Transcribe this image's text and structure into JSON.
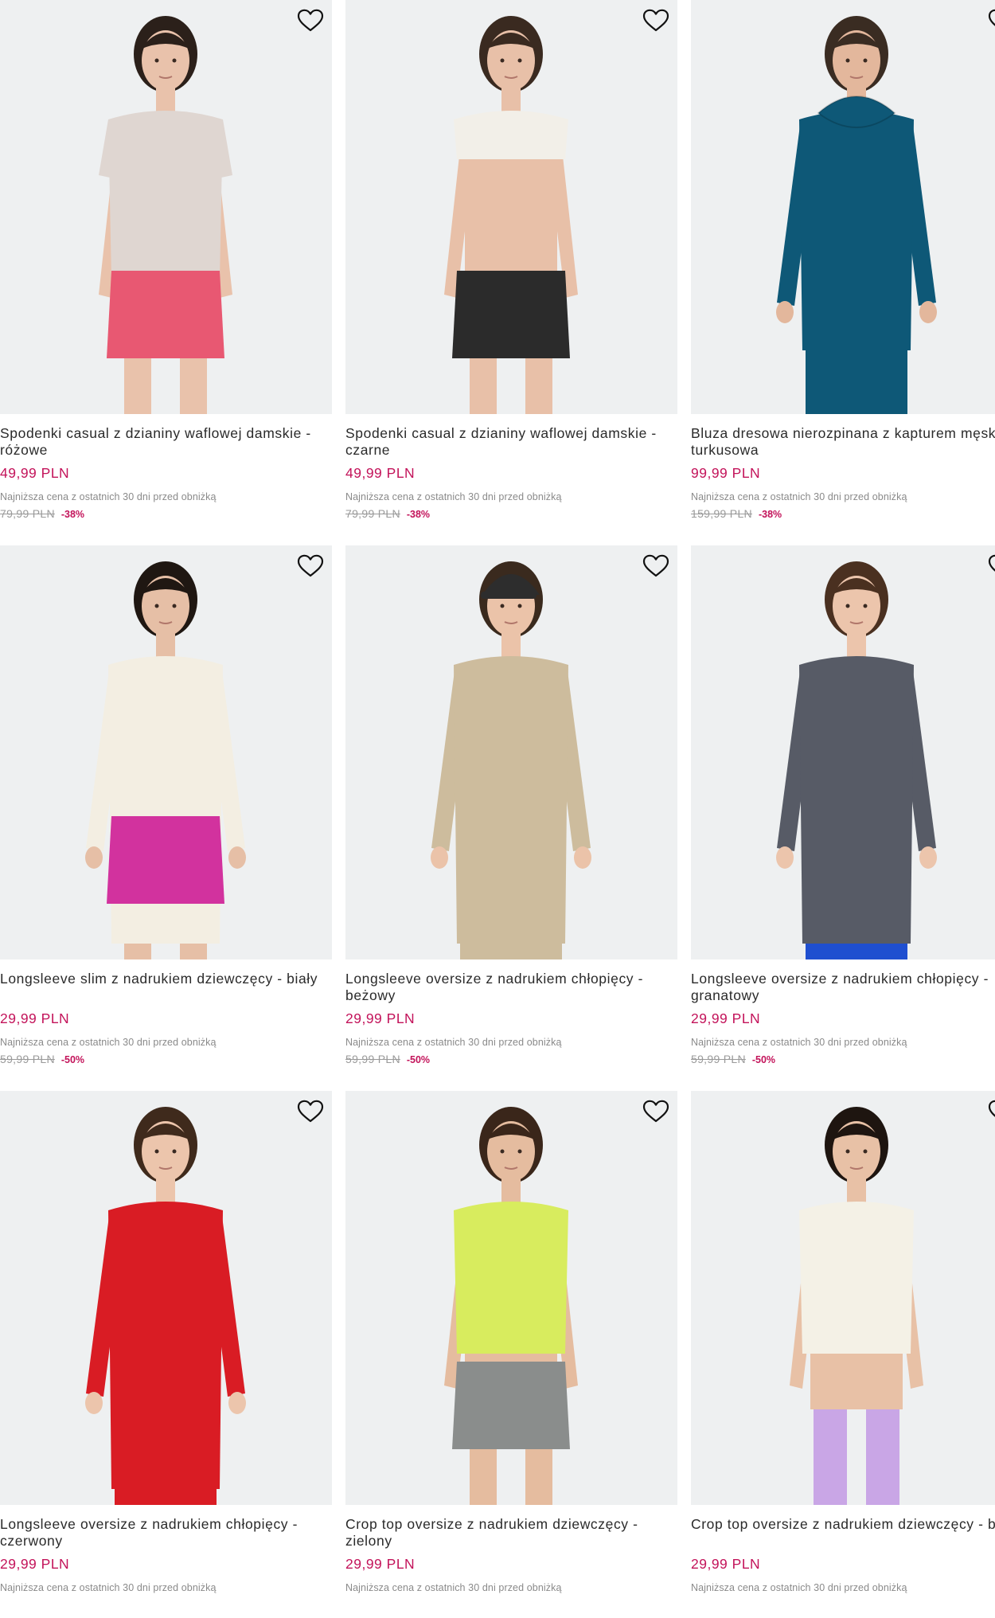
{
  "products": [
    {
      "name": "Spodenki casual z dzianiny waflowej damskie - różowe",
      "price": "49,99 PLN",
      "lowest_label": "Najniższa cena z ostatnich 30 dni przed obniżką",
      "old_price": "79,99 PLN",
      "discount": "-38%",
      "figure": {
        "skin": "#e9c2ab",
        "hair": "#2b201a",
        "top": "#dfd6d1",
        "top_type": "tee",
        "bottom": "#e85872",
        "bottom_type": "shorts",
        "legs": "#e9c2ab"
      }
    },
    {
      "name": "Spodenki casual z dzianiny waflowej damskie - czarne",
      "price": "49,99 PLN",
      "lowest_label": "Najniższa cena z ostatnich 30 dni przed obniżką",
      "old_price": "79,99 PLN",
      "discount": "-38%",
      "figure": {
        "skin": "#e8c0a8",
        "hair": "#3a2a20",
        "top": "#f2efe8",
        "top_type": "crop",
        "bottom": "#2b2b2b",
        "bottom_type": "shorts",
        "legs": "#e8c0a8"
      }
    },
    {
      "name": "Bluza dresowa nierozpinana z kapturem męska - turkusowa",
      "price": "99,99 PLN",
      "lowest_label": "Najniższa cena z ostatnich 30 dni przed obniżką",
      "old_price": "159,99 PLN",
      "discount": "-38%",
      "figure": {
        "skin": "#e3b79c",
        "hair": "#3a2c22",
        "top": "#0e5877",
        "top_type": "hoodie",
        "bottom": "#0e5877",
        "bottom_type": "pants",
        "legs": "#0e5877"
      }
    },
    {
      "name": "Longsleeve slim z nadrukiem dziewczęcy - biały",
      "price": "29,99 PLN",
      "lowest_label": "Najniższa cena z ostatnich 30 dni przed obniżką",
      "old_price": "59,99 PLN",
      "discount": "-50%",
      "figure": {
        "skin": "#e6bfa6",
        "hair": "#1f1712",
        "top": "#f3eee2",
        "top_type": "long",
        "bottom": "#d2329e",
        "bottom_type": "shorts",
        "legs": "#e6bfa6"
      }
    },
    {
      "name": "Longsleeve oversize z nadrukiem chłopięcy - beżowy",
      "price": "29,99 PLN",
      "lowest_label": "Najniższa cena z ostatnich 30 dni przed obniżką",
      "old_price": "59,99 PLN",
      "discount": "-50%",
      "figure": {
        "skin": "#ebc3a9",
        "hair": "#3a2a1e",
        "top": "#cdbc9d",
        "top_type": "long",
        "bottom": "#cdbc9d",
        "bottom_type": "none",
        "legs": "#cdbc9d",
        "cap": "#2d2d2d"
      }
    },
    {
      "name": "Longsleeve oversize z nadrukiem chłopięcy - granatowy",
      "price": "29,99 PLN",
      "lowest_label": "Najniższa cena z ostatnich 30 dni przed obniżką",
      "old_price": "59,99 PLN",
      "discount": "-50%",
      "figure": {
        "skin": "#ecc5ac",
        "hair": "#4a3020",
        "top": "#575b66",
        "top_type": "long",
        "bottom": "#1f4fd0",
        "bottom_type": "none",
        "legs": "#575b66"
      }
    },
    {
      "name": "Longsleeve oversize z nadrukiem chłopięcy - czerwony",
      "price": "29,99 PLN",
      "lowest_label": "Najniższa cena z ostatnich 30 dni przed obniżką",
      "old_price": "",
      "discount": "",
      "figure": {
        "skin": "#ecc5ac",
        "hair": "#3f2a1c",
        "top": "#d91c24",
        "top_type": "long",
        "bottom": "#d91c24",
        "bottom_type": "none",
        "legs": "#d91c24"
      }
    },
    {
      "name": "Crop top oversize z nadrukiem dziewczęcy - zielony",
      "price": "29,99 PLN",
      "lowest_label": "Najniższa cena z ostatnich 30 dni przed obniżką",
      "old_price": "",
      "discount": "",
      "figure": {
        "skin": "#e5bc9f",
        "hair": "#3a261a",
        "top": "#d8ec5e",
        "top_type": "tank",
        "bottom": "#8a8d8c",
        "bottom_type": "shorts",
        "legs": "#e5bc9f"
      }
    },
    {
      "name": "Crop top oversize z nadrukiem dziewczęcy - biały",
      "price": "29,99 PLN",
      "lowest_label": "Najniższa cena z ostatnich 30 dni przed obniżką",
      "old_price": "",
      "discount": "",
      "figure": {
        "skin": "#e8c1a6",
        "hair": "#1e1510",
        "top": "#f4f1e6",
        "top_type": "tank",
        "bottom": "#c9a6e6",
        "bottom_type": "leggings",
        "legs": "#c9a6e6"
      }
    }
  ],
  "icons": {
    "favorite": "heart-outline-icon"
  }
}
